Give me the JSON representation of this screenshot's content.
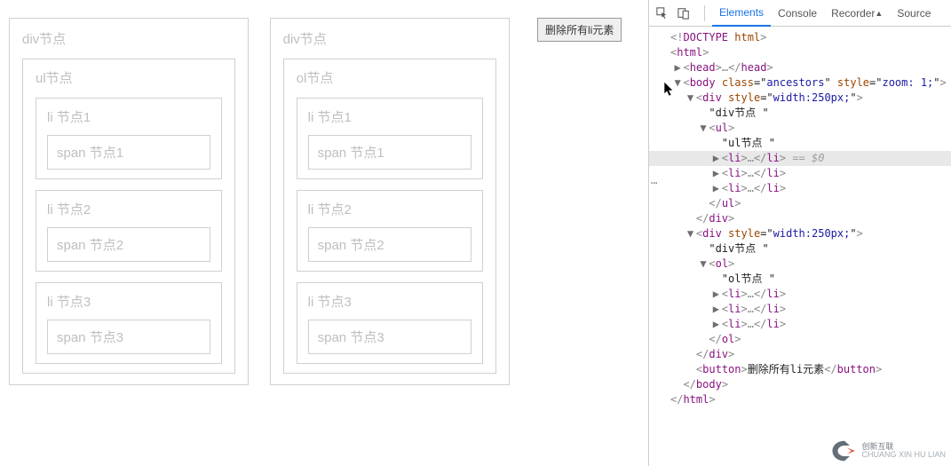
{
  "page": {
    "div1": {
      "label": "div节点",
      "list_label": "ul节点",
      "items": [
        {
          "li": "li 节点1",
          "span": "span 节点1"
        },
        {
          "li": "li 节点2",
          "span": "span 节点2"
        },
        {
          "li": "li 节点3",
          "span": "span 节点3"
        }
      ]
    },
    "div2": {
      "label": "div节点",
      "list_label": "ol节点",
      "items": [
        {
          "li": "li 节点1",
          "span": "span 节点1"
        },
        {
          "li": "li 节点2",
          "span": "span 节点2"
        },
        {
          "li": "li 节点3",
          "span": "span 节点3"
        }
      ]
    },
    "button_label": "删除所有li元素"
  },
  "devtools": {
    "tabs": {
      "elements": "Elements",
      "console": "Console",
      "recorder": "Recorder",
      "sources": "Source"
    },
    "dom_lines": [
      {
        "indent": 0,
        "arrow": "",
        "html": "<span class='punct'>&lt;!</span><span class='tag'>DOCTYPE</span> <span class='attr'>html</span><span class='punct'>&gt;</span>"
      },
      {
        "indent": 0,
        "arrow": "",
        "html": "<span class='punct'>&lt;</span><span class='tag'>html</span><span class='punct'>&gt;</span>"
      },
      {
        "indent": 1,
        "arrow": "▶",
        "html": "<span class='punct'>&lt;</span><span class='tag'>head</span><span class='punct'>&gt;</span><span class='ell'>…</span><span class='punct'>&lt;/</span><span class='tag'>head</span><span class='punct'>&gt;</span>"
      },
      {
        "indent": 1,
        "arrow": "▼",
        "html": "<span class='punct'>&lt;</span><span class='tag'>body</span> <span class='attr'>class</span>=\"<span class='val'>ancestors</span>\" <span class='attr'>style</span>=\"<span class='val'>zoom: 1;</span>\"<span class='punct'>&gt;</span>"
      },
      {
        "indent": 2,
        "arrow": "▼",
        "html": "<span class='punct'>&lt;</span><span class='tag'>div</span> <span class='attr'>style</span>=\"<span class='val'>width:250px;</span>\"<span class='punct'>&gt;</span>"
      },
      {
        "indent": 3,
        "arrow": "",
        "html": "<span class='txt'>\"div节点 \"</span>"
      },
      {
        "indent": 3,
        "arrow": "▼",
        "html": "<span class='punct'>&lt;</span><span class='tag'>ul</span><span class='punct'>&gt;</span>"
      },
      {
        "indent": 4,
        "arrow": "",
        "html": "<span class='txt'>\"ul节点 \"</span>"
      },
      {
        "indent": 4,
        "arrow": "▶",
        "hl": true,
        "html": "<span class='punct'>&lt;</span><span class='tag'>li</span><span class='punct'>&gt;</span><span class='ell'>…</span><span class='punct'>&lt;/</span><span class='tag'>li</span><span class='punct'>&gt;</span> <span class='eq0'>== $0</span>"
      },
      {
        "indent": 4,
        "arrow": "▶",
        "html": "<span class='punct'>&lt;</span><span class='tag'>li</span><span class='punct'>&gt;</span><span class='ell'>…</span><span class='punct'>&lt;/</span><span class='tag'>li</span><span class='punct'>&gt;</span>"
      },
      {
        "indent": 4,
        "arrow": "▶",
        "html": "<span class='punct'>&lt;</span><span class='tag'>li</span><span class='punct'>&gt;</span><span class='ell'>…</span><span class='punct'>&lt;/</span><span class='tag'>li</span><span class='punct'>&gt;</span>"
      },
      {
        "indent": 3,
        "arrow": "",
        "html": "<span class='punct'>&lt;/</span><span class='tag'>ul</span><span class='punct'>&gt;</span>"
      },
      {
        "indent": 2,
        "arrow": "",
        "html": "<span class='punct'>&lt;/</span><span class='tag'>div</span><span class='punct'>&gt;</span>"
      },
      {
        "indent": 2,
        "arrow": "▼",
        "html": "<span class='punct'>&lt;</span><span class='tag'>div</span> <span class='attr'>style</span>=\"<span class='val'>width:250px;</span>\"<span class='punct'>&gt;</span>"
      },
      {
        "indent": 3,
        "arrow": "",
        "html": "<span class='txt'>\"div节点 \"</span>"
      },
      {
        "indent": 3,
        "arrow": "▼",
        "html": "<span class='punct'>&lt;</span><span class='tag'>ol</span><span class='punct'>&gt;</span>"
      },
      {
        "indent": 4,
        "arrow": "",
        "html": "<span class='txt'>\"ol节点 \"</span>"
      },
      {
        "indent": 4,
        "arrow": "▶",
        "html": "<span class='punct'>&lt;</span><span class='tag'>li</span><span class='punct'>&gt;</span><span class='ell'>…</span><span class='punct'>&lt;/</span><span class='tag'>li</span><span class='punct'>&gt;</span>"
      },
      {
        "indent": 4,
        "arrow": "▶",
        "html": "<span class='punct'>&lt;</span><span class='tag'>li</span><span class='punct'>&gt;</span><span class='ell'>…</span><span class='punct'>&lt;/</span><span class='tag'>li</span><span class='punct'>&gt;</span>"
      },
      {
        "indent": 4,
        "arrow": "▶",
        "html": "<span class='punct'>&lt;</span><span class='tag'>li</span><span class='punct'>&gt;</span><span class='ell'>…</span><span class='punct'>&lt;/</span><span class='tag'>li</span><span class='punct'>&gt;</span>"
      },
      {
        "indent": 3,
        "arrow": "",
        "html": "<span class='punct'>&lt;/</span><span class='tag'>ol</span><span class='punct'>&gt;</span>"
      },
      {
        "indent": 2,
        "arrow": "",
        "html": "<span class='punct'>&lt;/</span><span class='tag'>div</span><span class='punct'>&gt;</span>"
      },
      {
        "indent": 2,
        "arrow": "",
        "html": "<span class='punct'>&lt;</span><span class='tag'>button</span><span class='punct'>&gt;</span><span class='txt'>删除所有li元素</span><span class='punct'>&lt;/</span><span class='tag'>button</span><span class='punct'>&gt;</span>"
      },
      {
        "indent": 1,
        "arrow": "",
        "html": "<span class='punct'>&lt;/</span><span class='tag'>body</span><span class='punct'>&gt;</span>"
      },
      {
        "indent": 0,
        "arrow": "",
        "html": "<span class='punct'>&lt;/</span><span class='tag'>html</span><span class='punct'>&gt;</span>"
      }
    ]
  },
  "watermark": {
    "line1": "创新互联",
    "line2": "CHUANG XIN HU LIAN"
  }
}
